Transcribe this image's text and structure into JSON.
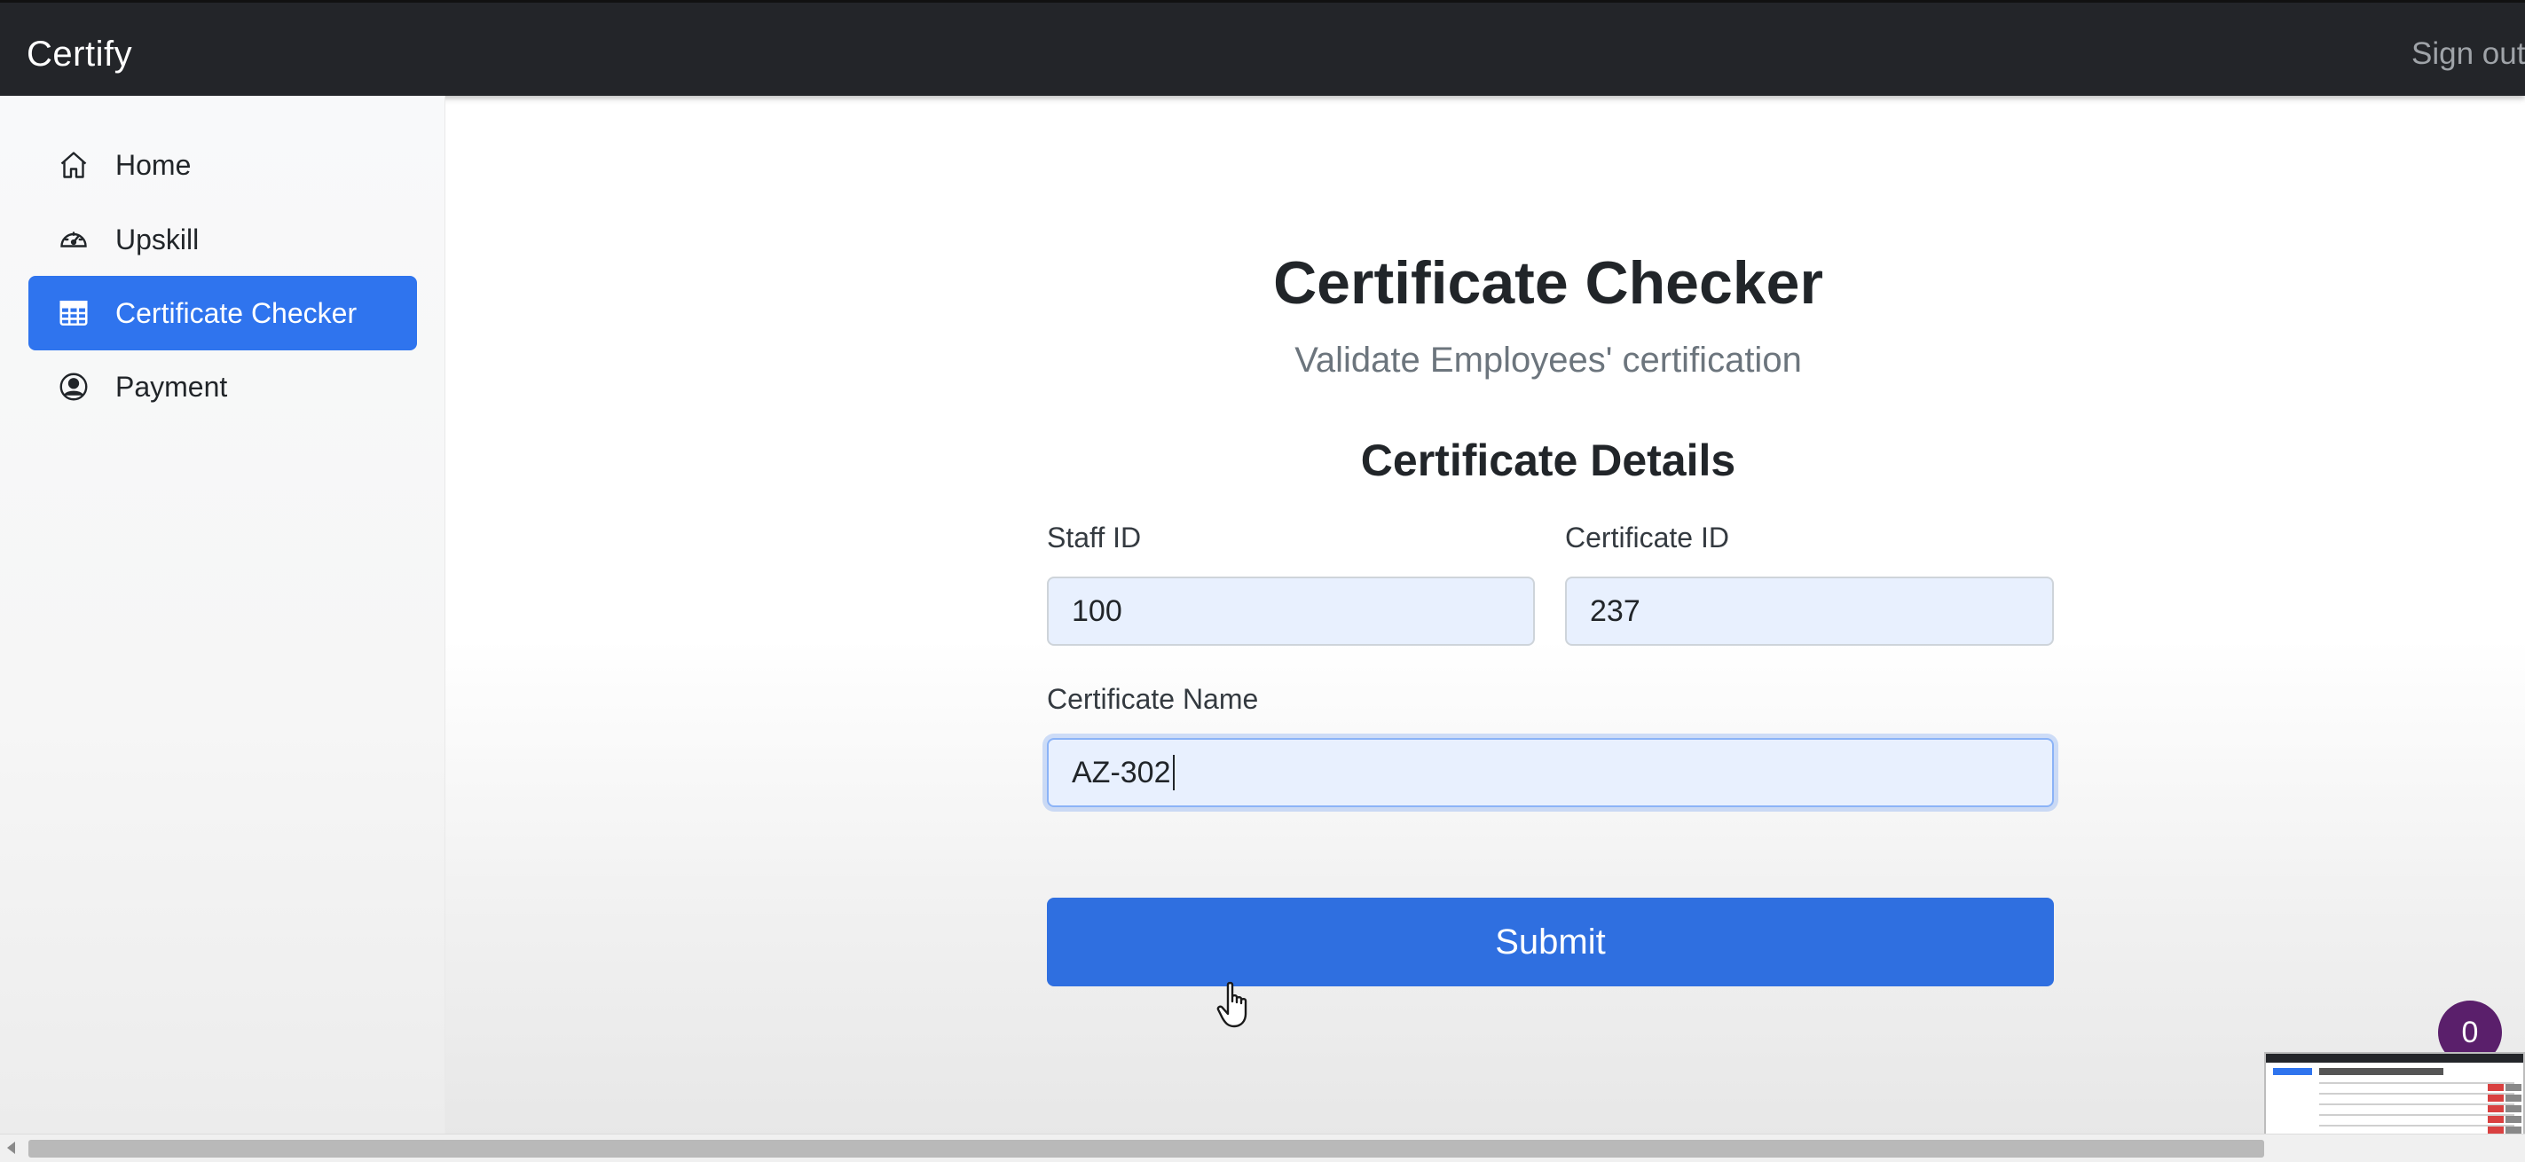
{
  "navbar": {
    "brand": "Certify",
    "signout": "Sign out"
  },
  "sidebar": {
    "items": [
      {
        "label": "Home",
        "icon": "house-icon"
      },
      {
        "label": "Upskill",
        "icon": "speedometer-icon"
      },
      {
        "label": "Certificate Checker",
        "icon": "table-icon",
        "active": true
      },
      {
        "label": "Payment",
        "icon": "person-circle-icon"
      }
    ]
  },
  "main": {
    "title": "Certificate Checker",
    "subtitle": "Validate Employees' certification",
    "section_title": "Certificate Details",
    "form": {
      "staff_id_label": "Staff ID",
      "staff_id_value": "100",
      "certificate_id_label": "Certificate ID",
      "certificate_id_value": "237",
      "certificate_name_label": "Certificate Name",
      "certificate_name_value": "AZ-302",
      "submit_label": "Submit"
    }
  },
  "notification_badge": "0",
  "colors": {
    "navbar": "#232529",
    "accent": "#2f74ee",
    "submit": "#2f6fe0",
    "badge": "#5a1f6b"
  }
}
